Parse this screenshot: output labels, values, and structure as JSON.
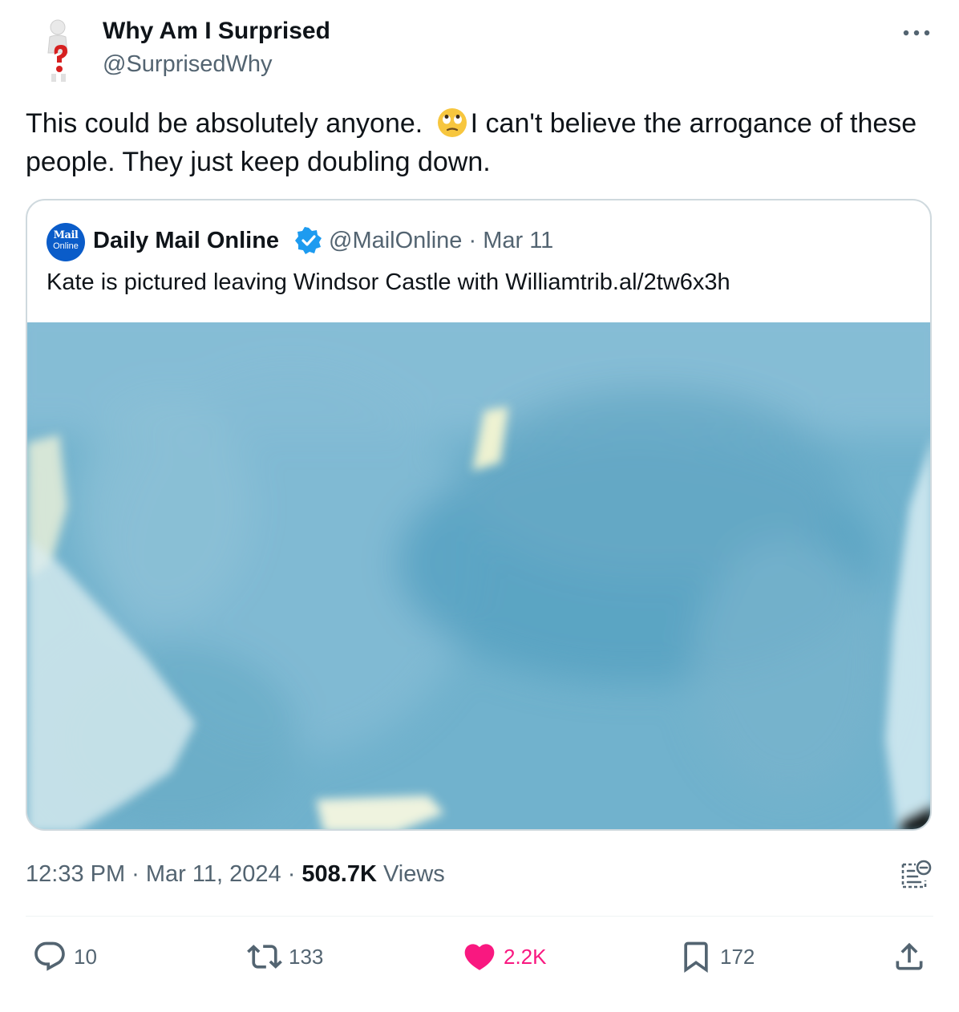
{
  "author": {
    "display_name": "Why Am I Surprised",
    "handle": "@SurprisedWhy",
    "avatar_icon": "question-mark-figure-icon"
  },
  "tweet": {
    "text_part1": "This could be absolutely anyone. ",
    "emoji": "face-with-rolling-eyes-icon",
    "text_part2": "I can't believe the arrogance of these people. They just keep doubling down."
  },
  "quote": {
    "avatar_line1": "Mail",
    "avatar_line2": "Online",
    "display_name": "Daily Mail Online",
    "handle_date": "@MailOnline · Mar 11",
    "text": "Kate is pictured leaving Windsor Castle with Williamtrib.al/2tw6x3h",
    "image_description": "blurry-car-window-photo"
  },
  "meta": {
    "time_date": "12:33 PM · Mar 11, 2024 · ",
    "views_count": "508.7K",
    "views_label": " Views"
  },
  "actions": {
    "replies": "10",
    "reposts": "133",
    "likes": "2.2K",
    "bookmarks": "172"
  },
  "colors": {
    "text_primary": "#0f1419",
    "text_secondary": "#536471",
    "like_pink": "#f91880",
    "verified_blue": "#1d9bf0",
    "photo_blue": "#6fb0cc"
  }
}
